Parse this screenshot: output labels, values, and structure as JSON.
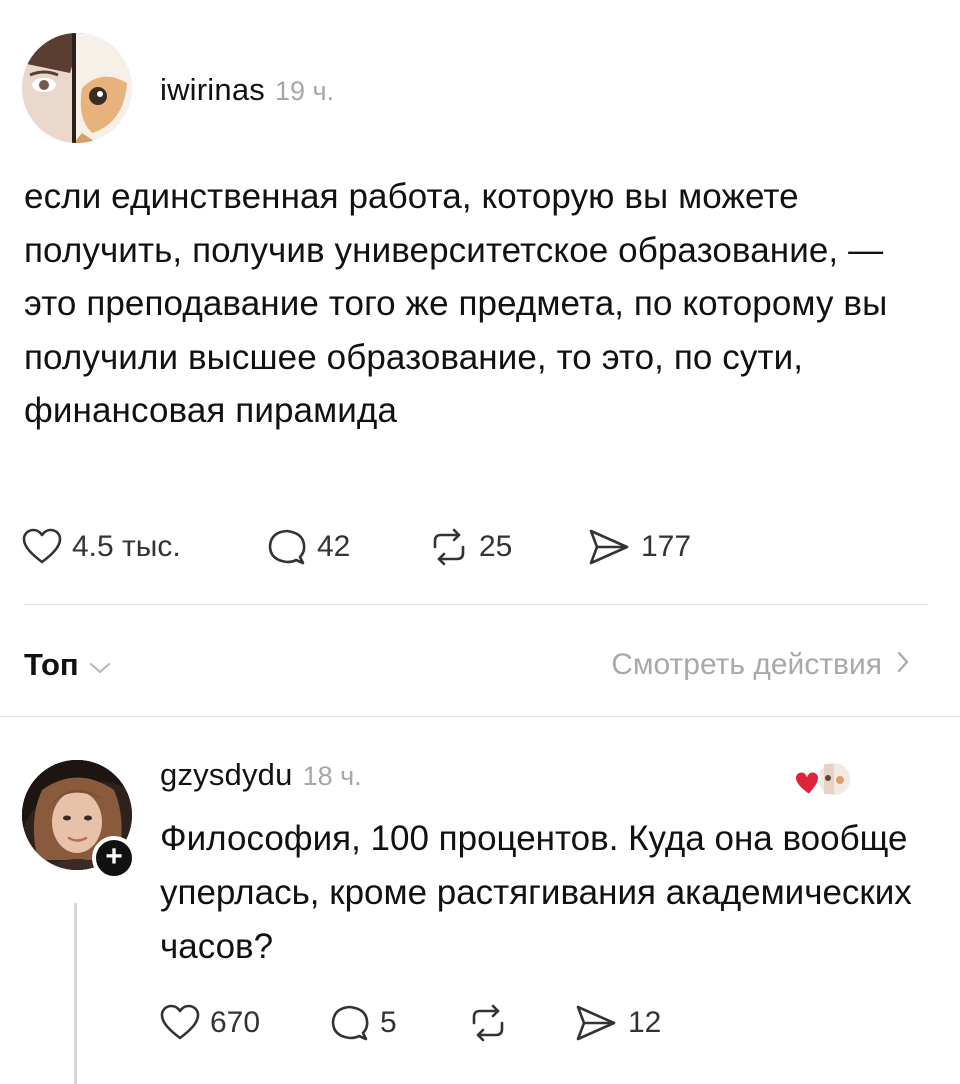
{
  "post": {
    "username": "iwirinas",
    "time": "19 ч.",
    "text": "если единственная работа, которую вы можете получить, получив университетское образование, — это преподавание того же предмета, по которому вы получили высшее образование, то это, по сути, финансовая пирамида",
    "stats": {
      "likes": "4.5 тыс.",
      "comments": "42",
      "reposts": "25",
      "shares": "177"
    }
  },
  "replies_bar": {
    "sort_label": "Топ",
    "activity_label": "Смотреть действия"
  },
  "reply": {
    "username": "gzysdydu",
    "time": "18 ч.",
    "follow_badge": "+",
    "text": "Философия, 100 процентов. Куда она вообще уперлась, кроме растягивания академических часов?",
    "stats": {
      "likes": "670",
      "comments": "5",
      "reposts": "",
      "shares": "12"
    }
  },
  "colors": {
    "text": "#111111",
    "muted": "#a7a7a7",
    "divider": "#e3e3e3",
    "like_heart": "#e0243a"
  }
}
